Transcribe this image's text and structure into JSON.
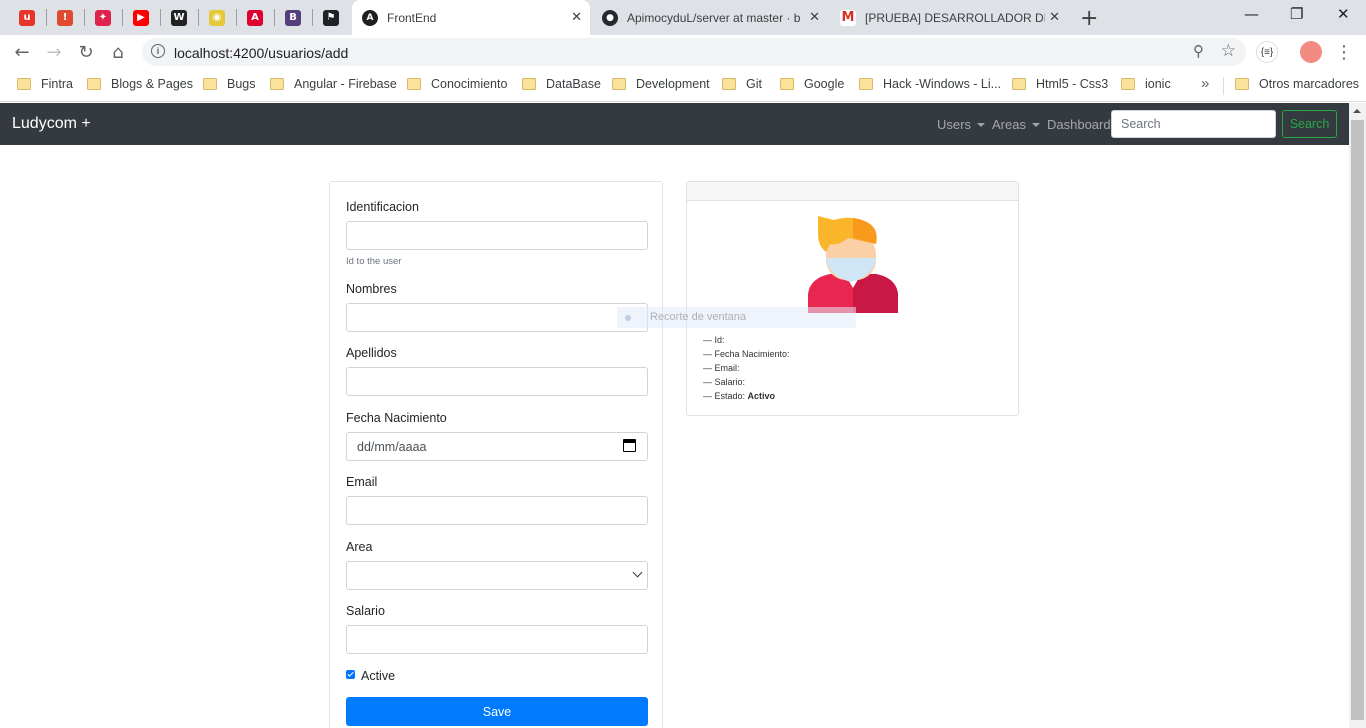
{
  "browser": {
    "pinned_tabs": [
      {
        "icon": "ludycom-u-icon",
        "glyph": "u",
        "color": "#e8342b"
      },
      {
        "icon": "alert-book-icon",
        "glyph": "!",
        "color": "#e04a2f"
      },
      {
        "icon": "nest-icon",
        "glyph": "✦",
        "color": "#e0234e"
      },
      {
        "icon": "youtube-icon",
        "glyph": "▶",
        "color": "#ff0000"
      },
      {
        "icon": "w-brand-icon",
        "glyph": "W",
        "color": "#222222"
      },
      {
        "icon": "ngrx-icon",
        "glyph": "◉",
        "color": "#e5c93b"
      },
      {
        "icon": "angular-icon",
        "glyph": "A",
        "color": "#dd0031"
      },
      {
        "icon": "bootstrap-icon",
        "glyph": "B",
        "color": "#563d7c"
      },
      {
        "icon": "flag-icon",
        "glyph": "⚑",
        "color": "#202124"
      }
    ],
    "tabs": [
      {
        "title": "FrontEnd",
        "active": true
      },
      {
        "title": "ApimocyduL/server at master · b",
        "active": false
      },
      {
        "title": "[PRUEBA] DESARROLLADOR DE A",
        "active": false
      }
    ],
    "new_tab_label": "+",
    "url": "localhost:4200/usuarios/add",
    "bookmarks": [
      "Fintra",
      "Blogs & Pages",
      "Bugs",
      "Angular - Firebase",
      "Conocimiento",
      "DataBase",
      "Development",
      "Git",
      "Google",
      "Hack -Windows - Li...",
      "Html5 - Css3",
      "ionic"
    ],
    "bookmarks_more": "»",
    "other_bookmarks": "Otros marcadores",
    "extension_label": "{≡}"
  },
  "navbar": {
    "brand": "Ludycom +",
    "links": [
      {
        "label": "Users",
        "dropdown": true
      },
      {
        "label": "Areas",
        "dropdown": true
      },
      {
        "label": "Dashboard",
        "dropdown": false
      }
    ],
    "search_placeholder": "Search",
    "search_button": "Search"
  },
  "form": {
    "id_label": "Identificacion",
    "id_help": "Id to the user",
    "nombres_label": "Nombres",
    "apellidos_label": "Apellidos",
    "fecha_label": "Fecha Nacimiento",
    "fecha_placeholder": "dd/mm/aaaa",
    "email_label": "Email",
    "area_label": "Area",
    "salario_label": "Salario",
    "active_label": "Active",
    "active_checked": true,
    "save_button": "Save"
  },
  "preview": {
    "id_label": "— Id:",
    "fecha_label": "— Fecha Nacimiento:",
    "email_label": "— Email:",
    "salario_label": "— Salario:",
    "estado_label": "— Estado:",
    "estado_value": "Activo"
  },
  "overlay": {
    "text": "Recorte de ventana"
  },
  "colors": {
    "navbar_bg": "#343a40",
    "primary": "#007bff",
    "success": "#28a745",
    "tabstrip": "#dee1e6"
  }
}
